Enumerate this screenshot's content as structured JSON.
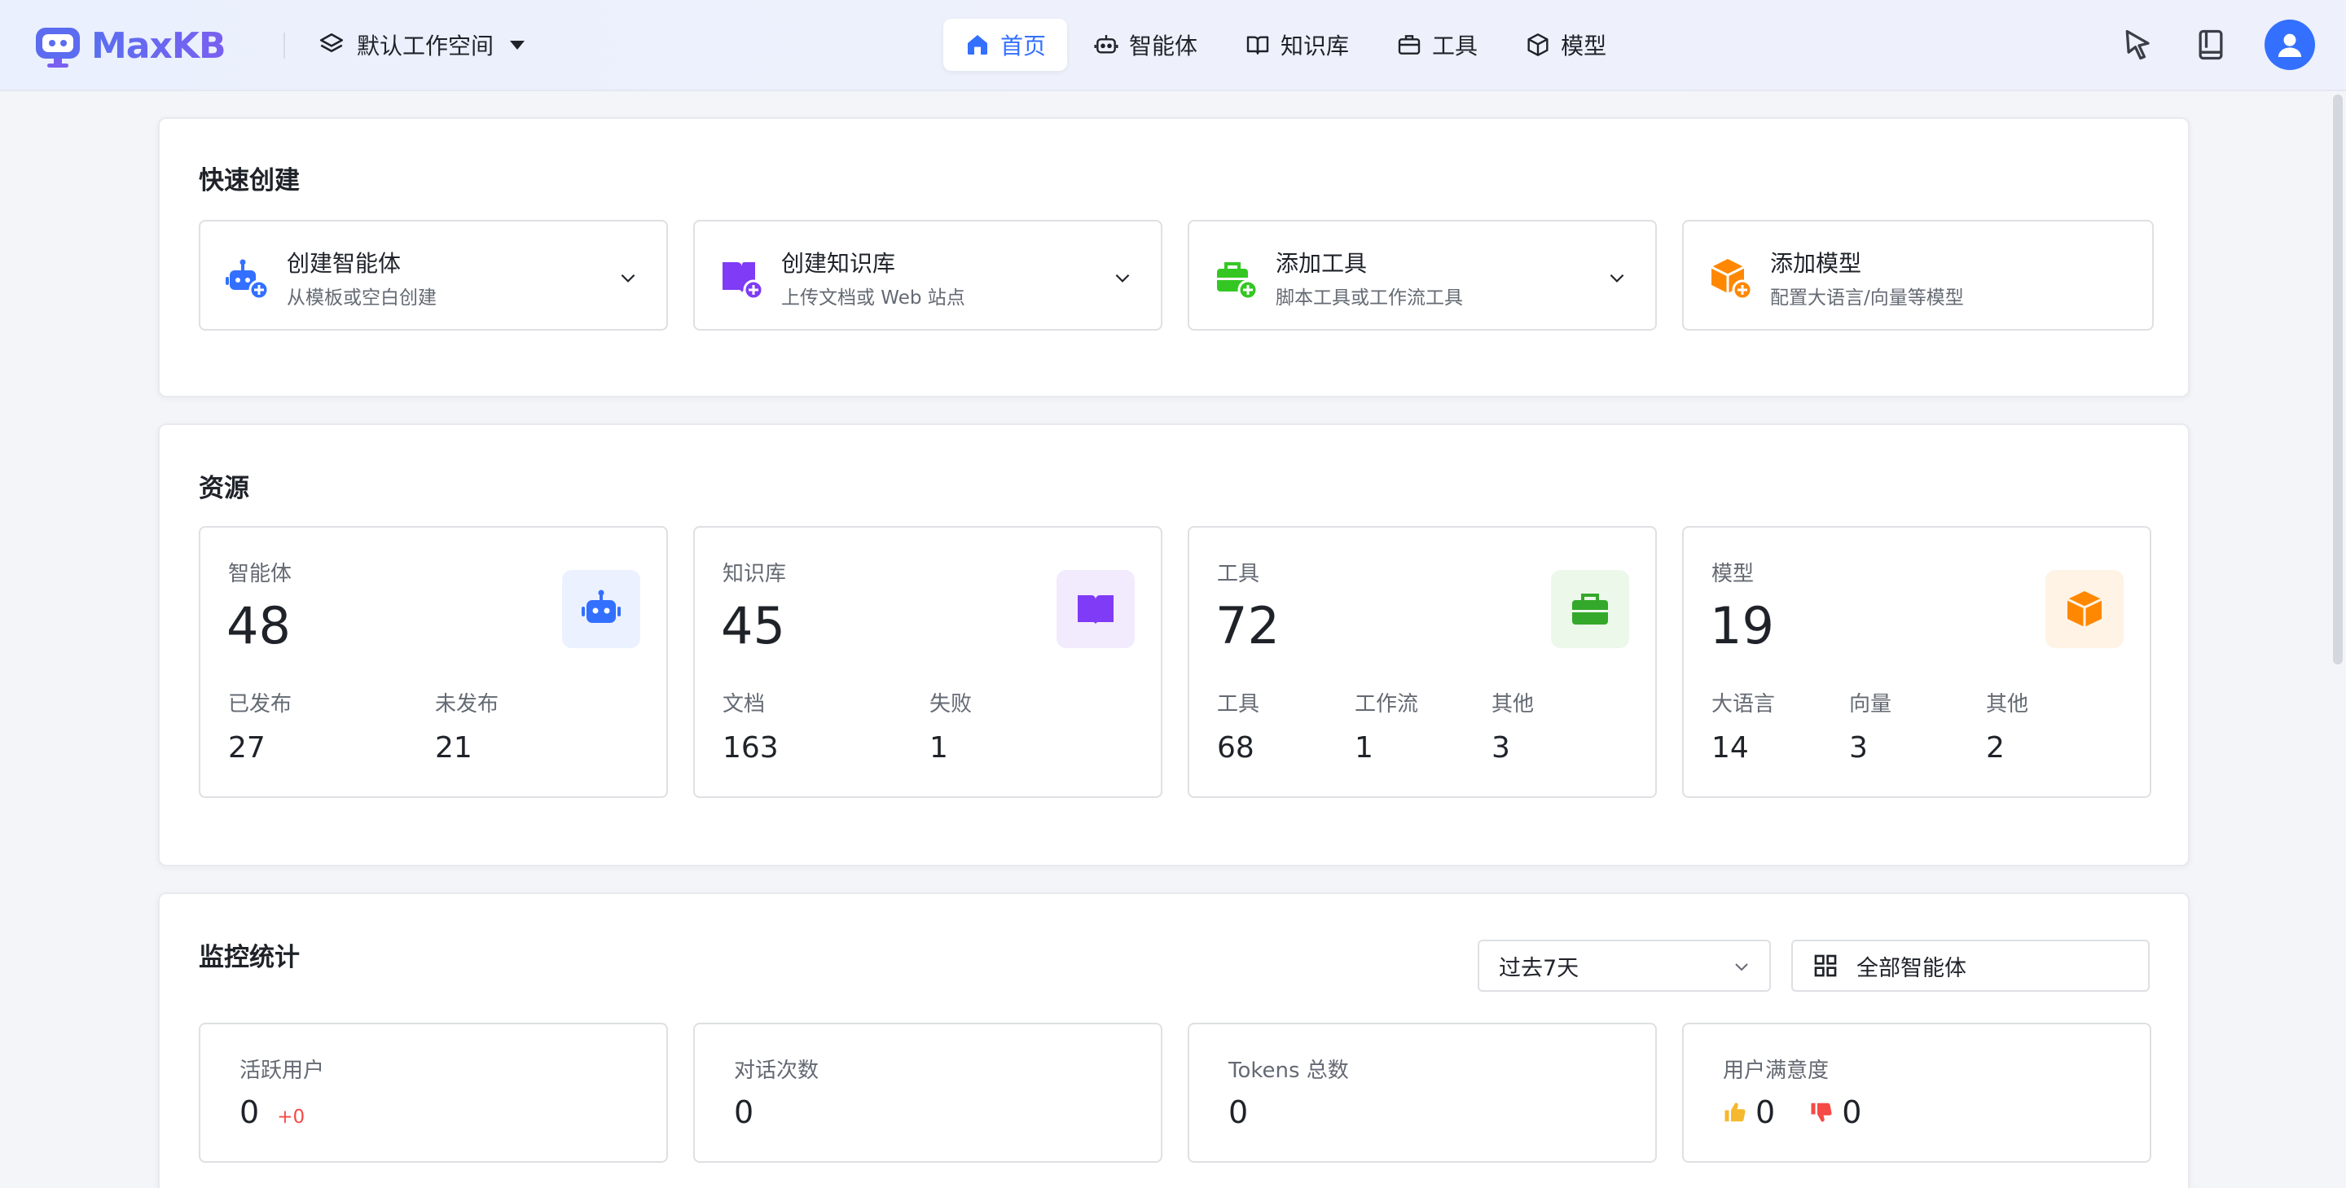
{
  "header": {
    "logo_text": "MaxKB",
    "workspace": "默认工作空间",
    "nav": [
      {
        "label": "首页",
        "icon": "home-icon",
        "active": true
      },
      {
        "label": "智能体",
        "icon": "robot-icon",
        "active": false
      },
      {
        "label": "知识库",
        "icon": "book-icon",
        "active": false
      },
      {
        "label": "工具",
        "icon": "toolbox-icon",
        "active": false
      },
      {
        "label": "模型",
        "icon": "cube-icon",
        "active": false
      }
    ],
    "right_icons": [
      "pointer-icon",
      "docs-icon",
      "user-avatar-icon"
    ]
  },
  "quick_create": {
    "title": "快速创建",
    "cards": [
      {
        "title": "创建智能体",
        "subtitle": "从模板或空白创建",
        "icon": "robot-plus-icon",
        "color": "#3370ff",
        "has_dropdown": true
      },
      {
        "title": "创建知识库",
        "subtitle": "上传文档或 Web 站点",
        "icon": "book-plus-icon",
        "color": "#7f3bf5",
        "has_dropdown": true
      },
      {
        "title": "添加工具",
        "subtitle": "脚本工具或工作流工具",
        "icon": "toolbox-plus-icon",
        "color": "#34c724",
        "has_dropdown": true
      },
      {
        "title": "添加模型",
        "subtitle": "配置大语言/向量等模型",
        "icon": "cube-plus-icon",
        "color": "#ff8800",
        "has_dropdown": false
      }
    ]
  },
  "resources": {
    "title": "资源",
    "cards": [
      {
        "label": "智能体",
        "count": "48",
        "icon": "robot-icon",
        "color": "#3370ff",
        "bg": "#ebf1ff",
        "stats": [
          {
            "label": "已发布",
            "value": "27"
          },
          {
            "label": "未发布",
            "value": "21"
          }
        ]
      },
      {
        "label": "知识库",
        "count": "45",
        "icon": "book-icon",
        "color": "#7f3bf5",
        "bg": "#f2ebfe",
        "stats": [
          {
            "label": "文档",
            "value": "163"
          },
          {
            "label": "失败",
            "value": "1"
          }
        ]
      },
      {
        "label": "工具",
        "count": "72",
        "icon": "toolbox-icon",
        "color": "#34a82a",
        "bg": "#ebf8ea",
        "stats": [
          {
            "label": "工具",
            "value": "68"
          },
          {
            "label": "工作流",
            "value": "1"
          },
          {
            "label": "其他",
            "value": "3"
          }
        ]
      },
      {
        "label": "模型",
        "count": "19",
        "icon": "cube-icon",
        "color": "#ff8800",
        "bg": "#fff3e5",
        "stats": [
          {
            "label": "大语言",
            "value": "14"
          },
          {
            "label": "向量",
            "value": "3"
          },
          {
            "label": "其他",
            "value": "2"
          }
        ]
      }
    ]
  },
  "monitor": {
    "title": "监控统计",
    "range_select": "过去7天",
    "app_filter": "全部智能体",
    "cards": [
      {
        "label": "活跃用户",
        "value": "0",
        "delta": "+0"
      },
      {
        "label": "对话次数",
        "value": "0"
      },
      {
        "label": "Tokens 总数",
        "value": "0"
      },
      {
        "label": "用户满意度",
        "like": "0",
        "dislike": "0"
      }
    ]
  }
}
